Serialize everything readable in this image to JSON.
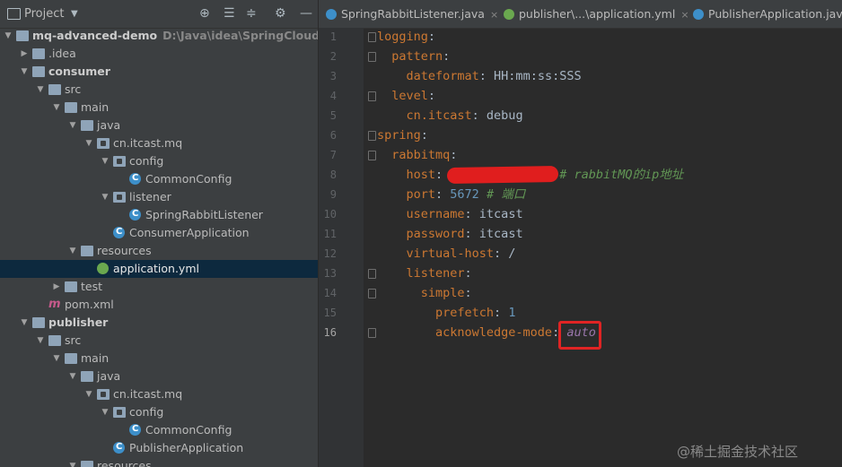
{
  "project": {
    "title": "Project",
    "header_icons": [
      "crosshair-icon",
      "expand-all-icon",
      "collapse-all-icon",
      "gear-icon",
      "hide-icon"
    ],
    "tree": [
      {
        "label": "mq-advanced-demo",
        "path": "D:\\Java\\idea\\SpringCloud\\mq-ac",
        "icon": "module-folder",
        "arrow": "down",
        "depth": 0,
        "bold": true
      },
      {
        "label": ".idea",
        "icon": "folder",
        "arrow": "right",
        "depth": 1
      },
      {
        "label": "consumer",
        "icon": "module-folder",
        "arrow": "down",
        "depth": 1,
        "bold": true
      },
      {
        "label": "src",
        "icon": "folder",
        "arrow": "down",
        "depth": 2
      },
      {
        "label": "main",
        "icon": "folder",
        "arrow": "down",
        "depth": 3
      },
      {
        "label": "java",
        "icon": "folder",
        "arrow": "down",
        "depth": 4
      },
      {
        "label": "cn.itcast.mq",
        "icon": "package",
        "arrow": "down",
        "depth": 5
      },
      {
        "label": "config",
        "icon": "package",
        "arrow": "down",
        "depth": 6
      },
      {
        "label": "CommonConfig",
        "icon": "class",
        "arrow": "",
        "depth": 7
      },
      {
        "label": "listener",
        "icon": "package",
        "arrow": "down",
        "depth": 6
      },
      {
        "label": "SpringRabbitListener",
        "icon": "class",
        "arrow": "",
        "depth": 7
      },
      {
        "label": "ConsumerApplication",
        "icon": "class",
        "arrow": "",
        "depth": 6
      },
      {
        "label": "resources",
        "icon": "folder",
        "arrow": "down",
        "depth": 4
      },
      {
        "label": "application.yml",
        "icon": "spring",
        "arrow": "",
        "depth": 5,
        "selected": true
      },
      {
        "label": "test",
        "icon": "folder",
        "arrow": "right",
        "depth": 3
      },
      {
        "label": "pom.xml",
        "icon": "maven",
        "arrow": "",
        "depth": 2
      },
      {
        "label": "publisher",
        "icon": "module-folder",
        "arrow": "down",
        "depth": 1,
        "bold": true
      },
      {
        "label": "src",
        "icon": "folder",
        "arrow": "down",
        "depth": 2
      },
      {
        "label": "main",
        "icon": "folder",
        "arrow": "down",
        "depth": 3
      },
      {
        "label": "java",
        "icon": "folder",
        "arrow": "down",
        "depth": 4
      },
      {
        "label": "cn.itcast.mq",
        "icon": "package",
        "arrow": "down",
        "depth": 5
      },
      {
        "label": "config",
        "icon": "package",
        "arrow": "down",
        "depth": 6
      },
      {
        "label": "CommonConfig",
        "icon": "class",
        "arrow": "",
        "depth": 7
      },
      {
        "label": "PublisherApplication",
        "icon": "class",
        "arrow": "",
        "depth": 6
      },
      {
        "label": "resources",
        "icon": "folder",
        "arrow": "down",
        "depth": 4
      }
    ]
  },
  "tabs": [
    {
      "label": "SpringRabbitListener.java",
      "icon": "class",
      "active": false
    },
    {
      "label": "publisher\\...\\application.yml",
      "icon": "spring",
      "active": false
    },
    {
      "label": "PublisherApplication.java",
      "icon": "class",
      "active": false
    }
  ],
  "editor": {
    "current_line": 16,
    "lines": [
      [
        {
          "t": "logging",
          "c": "key"
        },
        {
          "t": ":",
          "c": "val"
        }
      ],
      [
        {
          "t": "  pattern",
          "c": "key"
        },
        {
          "t": ":",
          "c": "val"
        }
      ],
      [
        {
          "t": "    dateformat",
          "c": "key"
        },
        {
          "t": ": HH:mm:ss:SSS",
          "c": "val"
        }
      ],
      [
        {
          "t": "  level",
          "c": "key"
        },
        {
          "t": ":",
          "c": "val"
        }
      ],
      [
        {
          "t": "    cn.itcast",
          "c": "key"
        },
        {
          "t": ": debug",
          "c": "val"
        }
      ],
      [
        {
          "t": "spring",
          "c": "key"
        },
        {
          "t": ":",
          "c": "val"
        }
      ],
      [
        {
          "t": "  rabbitmq",
          "c": "key"
        },
        {
          "t": ":",
          "c": "val"
        }
      ],
      [
        {
          "t": "    host",
          "c": "key"
        },
        {
          "t": ":                # rabbitMQ的ip地址",
          "c": "cmt-tail"
        }
      ],
      [
        {
          "t": "    port",
          "c": "key"
        },
        {
          "t": ": ",
          "c": "val"
        },
        {
          "t": "5672",
          "c": "num"
        },
        {
          "t": " # 端口",
          "c": "cmt"
        }
      ],
      [
        {
          "t": "    username",
          "c": "key"
        },
        {
          "t": ": itcast",
          "c": "val"
        }
      ],
      [
        {
          "t": "    password",
          "c": "key"
        },
        {
          "t": ": itcast",
          "c": "val"
        }
      ],
      [
        {
          "t": "    virtual-host",
          "c": "key"
        },
        {
          "t": ": /",
          "c": "val"
        }
      ],
      [
        {
          "t": "    listener",
          "c": "key"
        },
        {
          "t": ":",
          "c": "val"
        }
      ],
      [
        {
          "t": "      simple",
          "c": "key"
        },
        {
          "t": ":",
          "c": "val"
        }
      ],
      [
        {
          "t": "        prefetch",
          "c": "key"
        },
        {
          "t": ": ",
          "c": "val"
        },
        {
          "t": "1",
          "c": "num"
        }
      ],
      [
        {
          "t": "        acknowledge-mode",
          "c": "key"
        },
        {
          "t": ": ",
          "c": "val"
        },
        {
          "t": "auto",
          "c": "ital"
        }
      ]
    ]
  },
  "watermark": "@稀土掘金技术社区",
  "colors": {
    "highlight": "#e02424",
    "redaction": "#e01e1e",
    "selection": "#0d293e"
  }
}
